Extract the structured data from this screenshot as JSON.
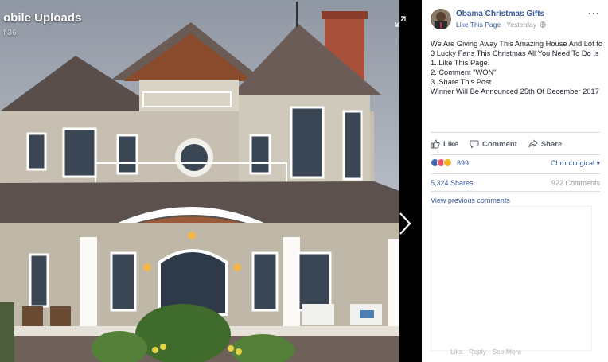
{
  "album": {
    "title": "obile Uploads",
    "subtitle": "f 36"
  },
  "post": {
    "page_name": "Obama Christmas Gifts",
    "like_page": "Like This Page",
    "separator": " · ",
    "time": "Yesterday",
    "privacy_icon": "globe-icon",
    "more": "···",
    "lines": [
      "We Are Giving Away This Amazing House And Lot to 3 Lucky Fans This Christmas All You Need To Do Is",
      "1. Like This Page.",
      "2. Comment \"WON\"",
      "3. Share This Post",
      "Winner Will Be Announced 25th Of December 2017"
    ]
  },
  "actions": {
    "like": "Like",
    "comment": "Comment",
    "share": "Share"
  },
  "reactions": {
    "count": "899",
    "order": "Chronological ▾",
    "colors": {
      "like": "#4267b2",
      "love": "#f25268",
      "wow": "#f7b125"
    }
  },
  "stats": {
    "shares": "5,324 Shares",
    "comments": "922 Comments",
    "view_previous": "View previous comments",
    "cut_links": "Like · Reply · See More"
  },
  "colors": {
    "link": "#365899",
    "muted": "#90949c",
    "text": "#1d2129"
  }
}
